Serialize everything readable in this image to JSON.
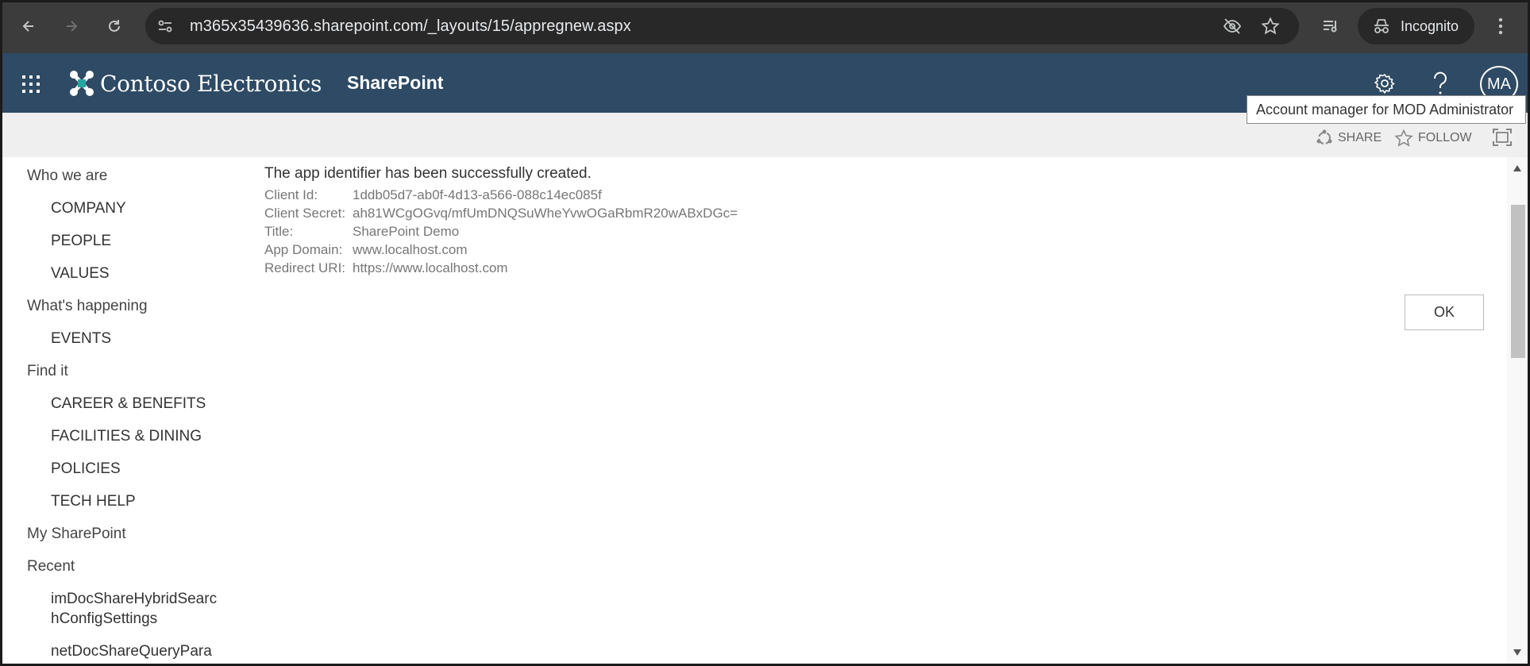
{
  "browser": {
    "url": "m365x35439636.sharepoint.com/_layouts/15/appregnew.aspx",
    "profile_label": "Incognito",
    "icons": [
      "back-icon",
      "forward-icon",
      "reload-icon",
      "site-info-icon",
      "eye-off-icon",
      "star-icon",
      "reading-list-icon",
      "incognito-icon",
      "more-icon"
    ]
  },
  "suite": {
    "brand": "Contoso Electronics",
    "app": "SharePoint",
    "avatar_initials": "MA",
    "tooltip": "Account manager for MOD Administrator",
    "header_color": "#2e4a64"
  },
  "toolbar": {
    "share": "SHARE",
    "follow": "FOLLOW"
  },
  "nav": [
    {
      "label": "Who we are",
      "level": 1
    },
    {
      "label": "COMPANY",
      "level": 2
    },
    {
      "label": "PEOPLE",
      "level": 2
    },
    {
      "label": "VALUES",
      "level": 2
    },
    {
      "label": "What's happening",
      "level": 1
    },
    {
      "label": "EVENTS",
      "level": 2
    },
    {
      "label": "Find it",
      "level": 1
    },
    {
      "label": "CAREER & BENEFITS",
      "level": 2
    },
    {
      "label": "FACILITIES & DINING",
      "level": 2
    },
    {
      "label": "POLICIES",
      "level": 2
    },
    {
      "label": "TECH HELP",
      "level": 2
    },
    {
      "label": "My SharePoint",
      "level": 1
    },
    {
      "label": "Recent",
      "level": 1
    },
    {
      "label": "imDocShareHybridSearc",
      "level": 2
    },
    {
      "label": "hConfigSettings",
      "level": 2
    },
    {
      "label": "netDocShareQueryPara",
      "level": 2
    }
  ],
  "result": {
    "message": "The app identifier has been successfully created.",
    "fields": [
      {
        "key": "Client Id:",
        "value": "1ddb05d7-ab0f-4d13-a566-088c14ec085f"
      },
      {
        "key": "Client Secret:",
        "value": "ah81WCgOGvq/mfUmDNQSuWheYvwOGaRbmR20wABxDGc="
      },
      {
        "key": "Title:",
        "value": "SharePoint Demo"
      },
      {
        "key": "App Domain:",
        "value": "www.localhost.com"
      },
      {
        "key": "Redirect URI:",
        "value": "https://www.localhost.com"
      }
    ],
    "ok_label": "OK"
  }
}
